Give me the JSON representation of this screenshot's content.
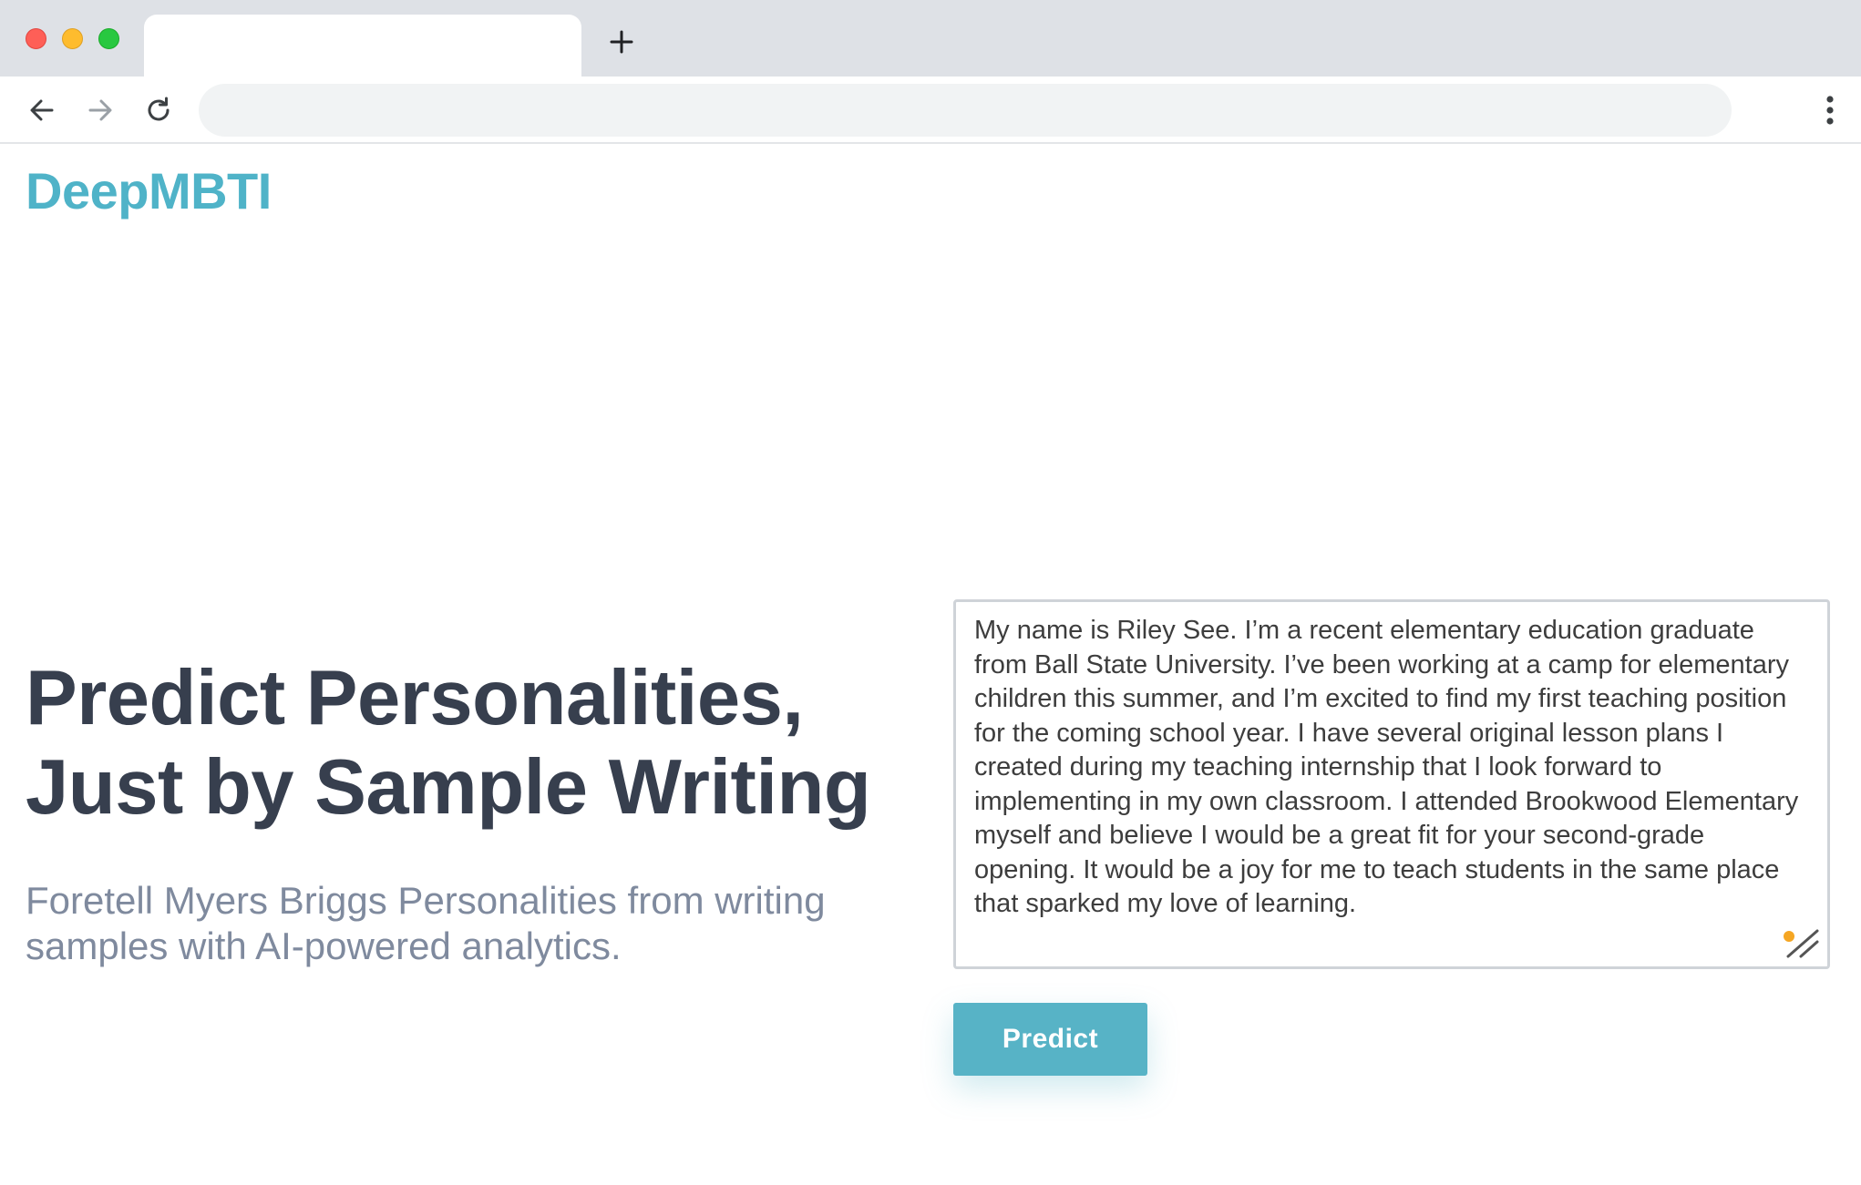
{
  "browser": {
    "tab_title": "",
    "new_tab_icon": "plus-icon",
    "address_value": "",
    "icons": {
      "back": "arrow-left-icon",
      "forward": "arrow-right-icon",
      "reload": "reload-icon",
      "menu": "kebab-menu-icon"
    }
  },
  "page": {
    "brand": "DeepMBTI",
    "hero": {
      "title_line1": "Predict Personalities,",
      "title_line2": "Just by Sample Writing",
      "subtitle": "Foretell Myers Briggs Personalities from writing samples with AI-powered analytics."
    },
    "sample_text": "My name is Riley See. I’m a recent elementary education graduate from Ball State University. I’ve been working at a camp for elementary children this summer, and I’m excited to find my first teaching position for the coming school year. I have several original lesson plans I created during my teaching internship that I look forward to implementing in my own classroom. I attended Brookwood Elementary myself and believe I would be a great fit for your second-grade opening. It would be a joy for me to teach students in the same place that sparked my love of learning.",
    "predict_label": "Predict"
  },
  "colors": {
    "brand": "#4fb3c8",
    "button": "#57b3c6",
    "heading": "#373f4e",
    "subtitle": "#7f8a9e",
    "tab_bar": "#dee1e6"
  }
}
